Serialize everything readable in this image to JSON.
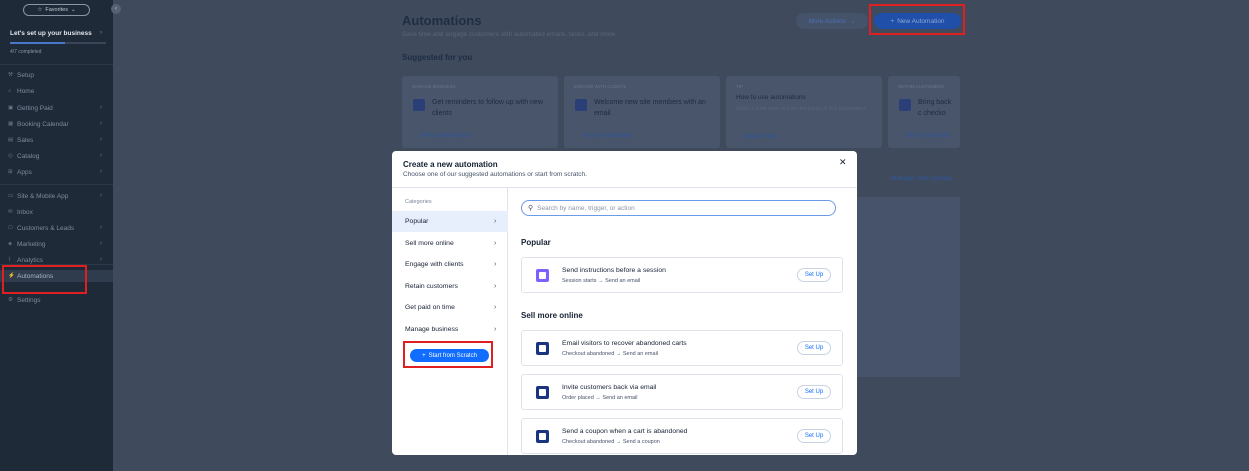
{
  "sidebar": {
    "favorites": "Favorites",
    "setup_title": "Let's set up your business",
    "setup_progress": 0.57,
    "completed": "4/7 completed",
    "items": [
      {
        "label": "Setup",
        "icon": "wrench-icon",
        "chev": false
      },
      {
        "label": "Home",
        "icon": "home-icon",
        "chev": false
      },
      {
        "label": "Getting Paid",
        "icon": "payment-icon",
        "chev": true
      },
      {
        "label": "Booking Calendar",
        "icon": "calendar-icon",
        "chev": true
      },
      {
        "label": "Sales",
        "icon": "sales-icon",
        "chev": true
      },
      {
        "label": "Catalog",
        "icon": "catalog-icon",
        "chev": true
      },
      {
        "label": "Apps",
        "icon": "apps-icon",
        "chev": true
      },
      {
        "label": "Site & Mobile App",
        "icon": "site-icon",
        "chev": true
      },
      {
        "label": "Inbox",
        "icon": "inbox-icon",
        "chev": false
      },
      {
        "label": "Customers & Leads",
        "icon": "customers-icon",
        "chev": true
      },
      {
        "label": "Marketing",
        "icon": "marketing-icon",
        "chev": true
      },
      {
        "label": "Analytics",
        "icon": "analytics-icon",
        "chev": true
      },
      {
        "label": "Automations",
        "icon": "automations-icon",
        "chev": false,
        "active": true
      },
      {
        "label": "Settings",
        "icon": "gear-icon",
        "chev": false
      }
    ]
  },
  "header": {
    "title": "Automations",
    "subtitle": "Save time and engage customers with automated emails, tasks, and more.",
    "more_actions": "More Actions",
    "new_automation": "New Automation"
  },
  "suggested": {
    "title": "Suggested for you",
    "cards": [
      {
        "kicker": "MANAGE BUSINESS",
        "text": "Get reminders to follow up with new clients",
        "link": "Set Up Automation"
      },
      {
        "kicker": "ENGAGE WITH CLIENTS",
        "text": "Welcome new site members with an email",
        "link": "Set Up Automation"
      },
      {
        "kicker": "TIP",
        "title": "How to use automations",
        "sub": "Watch a short video to learn the basics of Wix Automations",
        "link": "Watch Now"
      },
      {
        "kicker": "RETAIN CUSTOMERS",
        "text": "Bring back c checko",
        "link": "Set Up Automati"
      }
    ],
    "manage_quotas": "Manage Your Quotas"
  },
  "modal": {
    "title": "Create a new automation",
    "subtitle": "Choose one of our suggested automations or start from scratch.",
    "categories_label": "Categories",
    "categories": [
      "Popular",
      "Sell more online",
      "Engage with clients",
      "Retain customers",
      "Get paid on time",
      "Manage business"
    ],
    "start_scratch": "Start from Scratch",
    "search_placeholder": "Search by name, trigger, or action",
    "sections": [
      {
        "title": "Popular",
        "items": [
          {
            "name": "Send instructions before a session",
            "trigger": "Session starts",
            "action": "Send an email",
            "icon_color": "#7b61ff",
            "setup": "Set Up"
          }
        ]
      },
      {
        "title": "Sell more online",
        "items": [
          {
            "name": "Email visitors to recover abandoned carts",
            "trigger": "Checkout abandoned",
            "action": "Send an email",
            "icon_color": "#1a3580",
            "setup": "Set Up"
          },
          {
            "name": "Invite customers back via email",
            "trigger": "Order placed",
            "action": "Send an email",
            "icon_color": "#1a3580",
            "setup": "Set Up"
          },
          {
            "name": "Send a coupon when a cart is abandoned",
            "trigger": "Checkout abandoned",
            "action": "Send a coupon",
            "icon_color": "#1a3580",
            "setup": "Set Up"
          }
        ]
      }
    ]
  }
}
